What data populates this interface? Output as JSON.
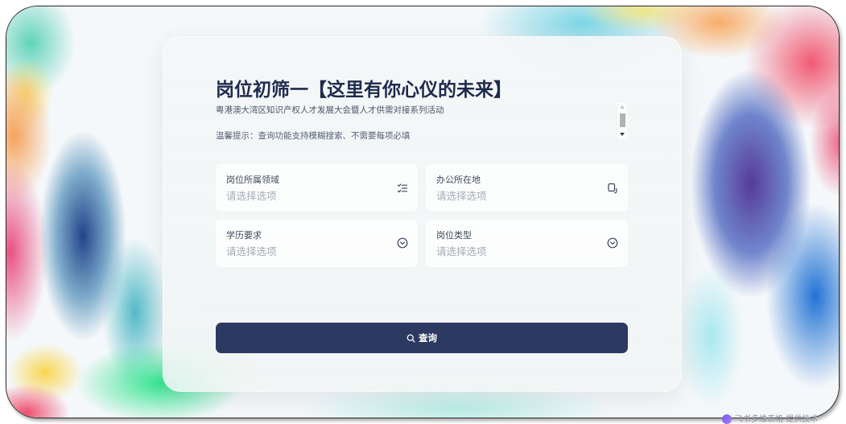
{
  "theme": {
    "accent": "#2c3a61",
    "title_color": "#1e2b4c"
  },
  "form": {
    "title": "岗位初筛一【这里有你心仪的未来】",
    "subtitle": "粤港澳大湾区知识产权人才发展大会暨人才供需对接系列活动",
    "hint": "温馨提示：查询功能支持模糊搜索、不需要每项必填",
    "fields": [
      {
        "label": "岗位所属领域",
        "placeholder": "请选择选项",
        "icon": "checklist-icon"
      },
      {
        "label": "办公所在地",
        "placeholder": "请选择选项",
        "icon": "device-icon"
      },
      {
        "label": "学历要求",
        "placeholder": "请选择选项",
        "icon": "chevron-down-circle-icon"
      },
      {
        "label": "岗位类型",
        "placeholder": "请选择选项",
        "icon": "chevron-down-circle-icon"
      }
    ],
    "submit": {
      "label": "查询",
      "icon": "search-icon"
    }
  },
  "footer": {
    "text": "飞书多维表格 提供技术",
    "icon": "feishu-logo-icon"
  }
}
